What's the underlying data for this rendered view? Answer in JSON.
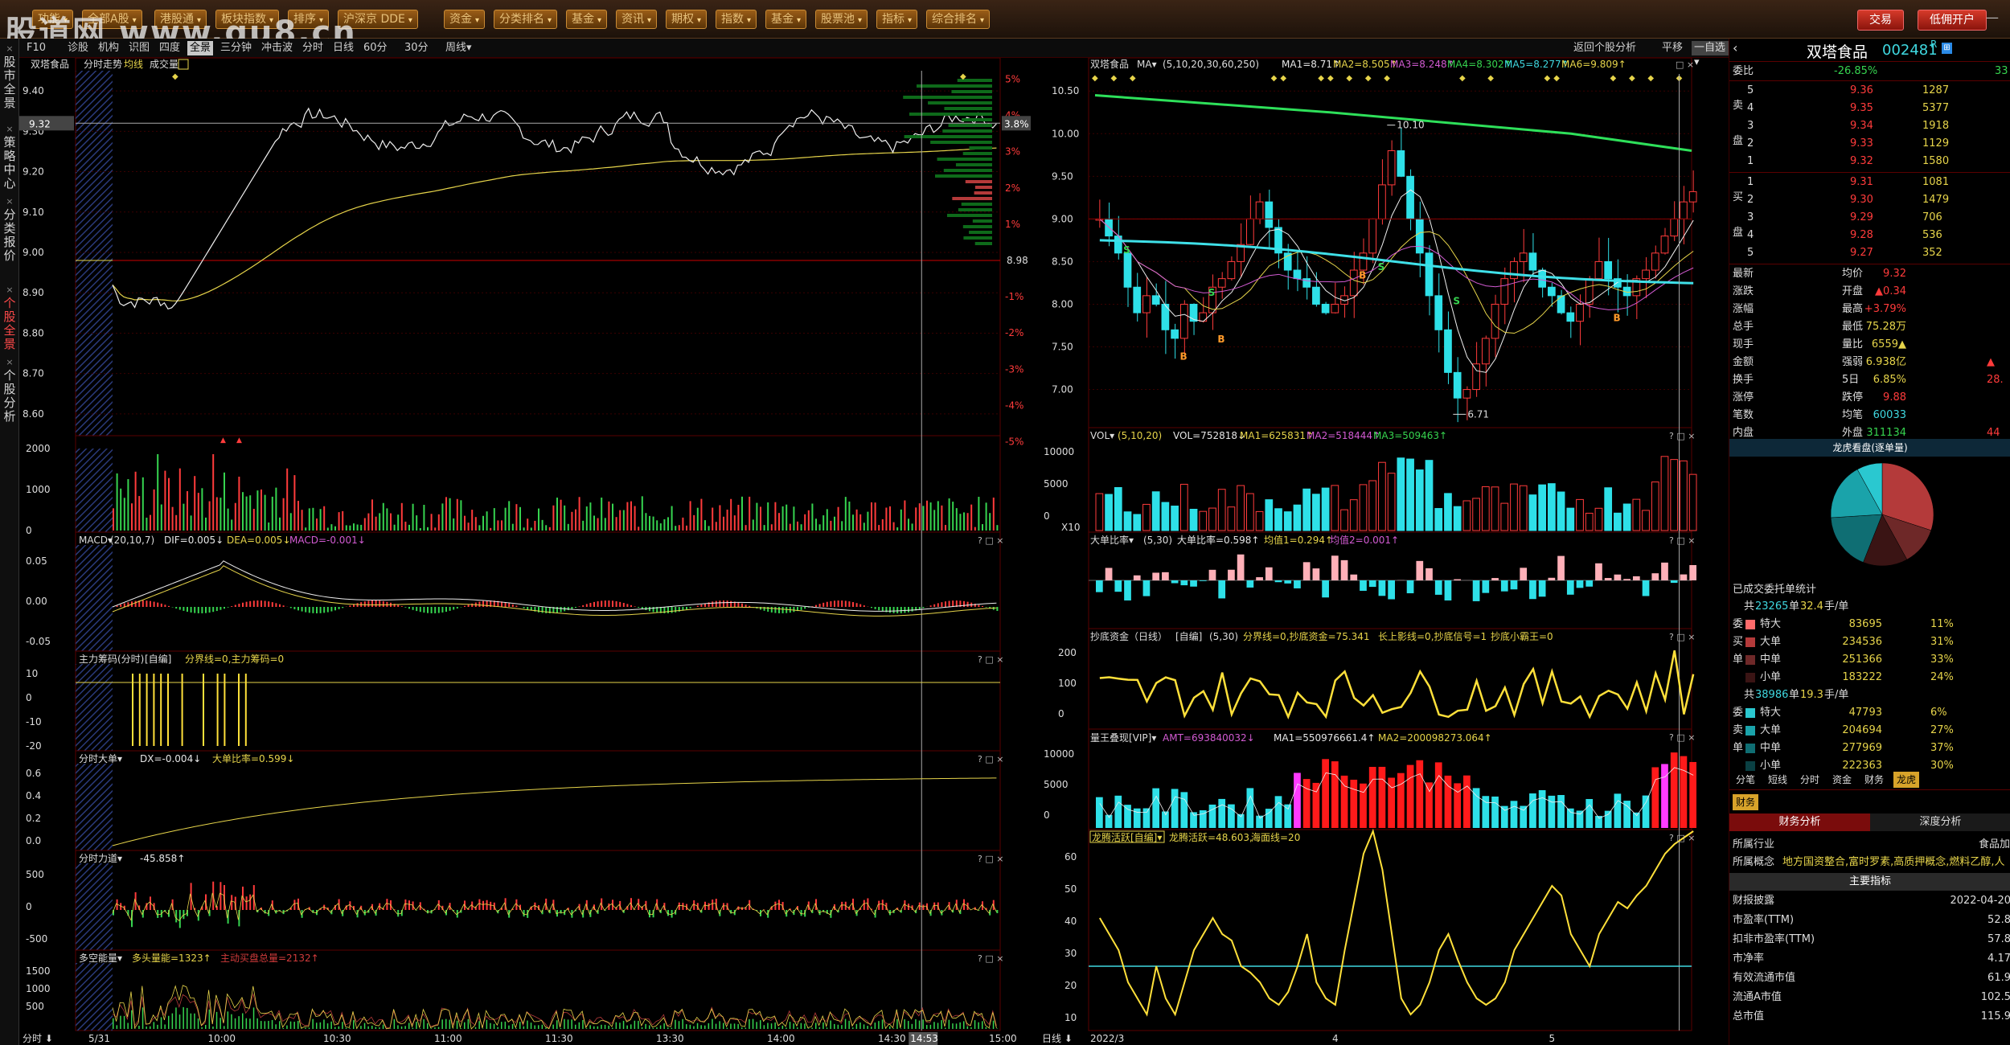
{
  "watermark": "股道网 www.gu8.cn",
  "toolbar": {
    "items": [
      {
        "label": "功能"
      },
      {
        "label": "全部A股"
      },
      {
        "label": "港股通"
      },
      {
        "label": "板块指数"
      },
      {
        "label": "排序"
      },
      {
        "label": "沪深京 DDE"
      },
      {
        "label": "资金"
      },
      {
        "label": "分类排名"
      },
      {
        "label": "基金"
      },
      {
        "label": "资讯"
      },
      {
        "label": "期权"
      },
      {
        "label": "指数"
      },
      {
        "label": "基金"
      },
      {
        "label": "股票池"
      },
      {
        "label": "指标"
      },
      {
        "label": "综合排名"
      }
    ],
    "trade_btn": "交易",
    "open_btn": "低佣开户"
  },
  "leftbar": {
    "sections": [
      {
        "text": "股市全景",
        "active": false
      },
      {
        "text": "策略中心",
        "active": false
      },
      {
        "text": "分类报价",
        "active": false
      },
      {
        "text": "个股全景",
        "active": true
      },
      {
        "text": "个股分析",
        "active": false
      }
    ]
  },
  "menu": {
    "items": [
      "F10",
      "诊股",
      "机构",
      "识图",
      "四度",
      "全景",
      "三分钟",
      "冲击波",
      "分时",
      "日线",
      "60分",
      "30分",
      "周线▾"
    ],
    "active": "全景"
  },
  "midbar": {
    "back": "返回个股分析",
    "flat": "平移",
    "select": "一自选▾"
  },
  "intraday": {
    "title": "双塔食品",
    "sub": "分时走势",
    "avg": "均线",
    "vol": "成交量",
    "price_axis": [
      "9.40",
      "9.30",
      "9.20",
      "9.10",
      "9.00",
      "8.90",
      "8.80",
      "8.70",
      "8.60"
    ],
    "pct_axis": [
      "5%",
      "4%",
      "3%",
      "2%",
      "1%",
      "-1%",
      "-2%",
      "-3%",
      "-4%",
      "-5%"
    ],
    "ref_price": "8.98",
    "cursor_price": "9.32",
    "cursor_pct": "3.8%",
    "vol_axis": [
      "2000",
      "1000",
      "0"
    ],
    "macd": {
      "name": "MACD",
      "params": "(20,10,7)",
      "dif": "DIF=0.005",
      "dea": "DEA=0.005",
      "macd": "MACD=-0.001",
      "axis": [
        "0.05",
        "0.00",
        "-0.05"
      ]
    },
    "zlcm": {
      "name": "主力筹码(分时)",
      "mode": "[自编]",
      "text": "分界线=0,主力筹码=0",
      "axis": [
        "10",
        "0",
        "-10",
        "-20"
      ]
    },
    "dadan": {
      "name": "分时大单",
      "dx": "DX=-0.004",
      "bili": "大单比率=0.599",
      "axis": [
        "0.6",
        "0.4",
        "0.2",
        "0.0"
      ]
    },
    "lidao": {
      "name": "分时力道",
      "val": "-45.858",
      "axis": [
        "500",
        "0",
        "-500"
      ]
    },
    "duokong": {
      "name": "多空能量",
      "bull": "多头量能=1323",
      "bear": "主动买盘总量=2132",
      "axis": [
        "1500",
        "1000",
        "500"
      ]
    },
    "time_axis": [
      "5/31",
      "10:00",
      "10:30",
      "11:00",
      "11:30",
      "13:30",
      "14:00",
      "14:30",
      "15:00"
    ],
    "cursor_time": "14:53",
    "period": "分时"
  },
  "daily": {
    "title": "双塔食品",
    "ma_label": "MA",
    "ma_params": "(5,10,20,30,60,250)",
    "ma_values": [
      {
        "t": "MA1=8.71",
        "c": "#e6e6e6"
      },
      {
        "t": "MA2=8.505",
        "c": "#e6d44a"
      },
      {
        "t": "MA3=8.248",
        "c": "#d25bd2"
      },
      {
        "t": "MA4=8.302",
        "c": "#36d44f"
      },
      {
        "t": "MA5=8.277",
        "c": "#3fd8e0"
      },
      {
        "t": "MA6=9.809",
        "c": "#e6d44a"
      }
    ],
    "price_axis": [
      "10.50",
      "10.00",
      "9.50",
      "9.00",
      "8.50",
      "8.00",
      "7.50",
      "7.00"
    ],
    "high_mark": "10.10",
    "low_mark": "6.71",
    "vol": {
      "name": "VOL",
      "params": "(5,10,20)",
      "v": "VOL=752818",
      "ma1": "MA1=625831",
      "ma2": "MA2=518444",
      "ma3": "MA3=509463",
      "axis": [
        "10000",
        "5000",
        "0"
      ],
      "unit": "X10"
    },
    "dadan": {
      "name": "大单比率",
      "params": "(5,30)",
      "v": "大单比率=0.598",
      "m1": "均值1=0.294",
      "m2": "均值2=0.001"
    },
    "chaodi": {
      "name": "抄底资金（日线）",
      "mode": "[自编]",
      "params": "(5,30)",
      "text": "分界线=0,抄底资金=75.341",
      "t2": "长上影线=0,抄底信号=1",
      "t3": "抄底小霸王=0",
      "axis": [
        "200",
        "100",
        "0"
      ]
    },
    "liangwang": {
      "name": "量王叠现[VIP]",
      "amt": "AMT=693840032",
      "ma1": "MA1=550976661.4",
      "ma2": "MA2=200098273.064",
      "axis": [
        "10000",
        "5000",
        "0"
      ]
    },
    "longteng": {
      "name": "龙腾活跃[自编]",
      "v": "龙腾活跃=48.603",
      "sea": "海面线=20",
      "axis": [
        "60",
        "50",
        "40",
        "30",
        "20",
        "10"
      ]
    },
    "time_axis": [
      "2022/3",
      "4",
      "5"
    ],
    "period": "日线"
  },
  "right": {
    "name": "双塔食品",
    "code": "002481",
    "r_tag": "R",
    "webi": {
      "label": "委比",
      "pct": "-26.85%",
      "diff": "33"
    },
    "asks": [
      {
        "n": "5",
        "p": "9.36",
        "v": "1287"
      },
      {
        "n": "4",
        "p": "9.35",
        "v": "5377"
      },
      {
        "n": "3",
        "p": "9.34",
        "v": "1918"
      },
      {
        "n": "2",
        "p": "9.33",
        "v": "1129"
      },
      {
        "n": "1",
        "p": "9.32",
        "v": "1580"
      }
    ],
    "bids": [
      {
        "n": "1",
        "p": "9.31",
        "v": "1081"
      },
      {
        "n": "2",
        "p": "9.30",
        "v": "1479"
      },
      {
        "n": "3",
        "p": "9.29",
        "v": "706"
      },
      {
        "n": "4",
        "p": "9.28",
        "v": "536"
      },
      {
        "n": "5",
        "p": "9.27",
        "v": "352"
      }
    ],
    "sell_chars": [
      "卖",
      "盘"
    ],
    "buy_chars": [
      "买",
      "盘"
    ],
    "quote": [
      {
        "l": "最新",
        "v": "9.32",
        "c": "#ff3b3b",
        "l2": "均价",
        "v2": ""
      },
      {
        "l": "涨跌",
        "v": "▲0.34",
        "c": "#ff3b3b",
        "l2": "开盘",
        "v2": ""
      },
      {
        "l": "涨幅",
        "v": "+3.79%",
        "c": "#ff3b3b",
        "l2": "最高",
        "v2": ""
      },
      {
        "l": "总手",
        "v": "75.28万",
        "c": "#e6d44a",
        "l2": "最低",
        "v2": ""
      },
      {
        "l": "现手",
        "v": "6559▲",
        "c": "#e6d44a",
        "l2": "量比",
        "v2": ""
      },
      {
        "l": "金额",
        "v": "6.938亿",
        "c": "#e6d44a",
        "l2": "强弱",
        "v2": "▲"
      },
      {
        "l": "换手",
        "v": "6.85%",
        "c": "#e6d44a",
        "l2": "5日",
        "v2": "28."
      },
      {
        "l": "涨停",
        "v": "9.88",
        "c": "#ff3b3b",
        "l2": "跌停",
        "v2": ""
      },
      {
        "l": "笔数",
        "v": "60033",
        "c": "#3fd8e0",
        "l2": "均笔",
        "v2": ""
      },
      {
        "l": "内盘",
        "v": "311134",
        "c": "#36d44f",
        "l2": "外盘",
        "v2": "44"
      }
    ],
    "pie_title": "龙虎看盘(逐单量)",
    "pie": [
      {
        "v": 30,
        "c": "#b43a3a"
      },
      {
        "v": 12,
        "c": "#6e2828"
      },
      {
        "v": 14,
        "c": "#3a1414"
      },
      {
        "v": 18,
        "c": "#0f6e73"
      },
      {
        "v": 18,
        "c": "#1aa3aa"
      },
      {
        "v": 8,
        "c": "#2ac8d0"
      }
    ],
    "deal_title": "已成交委托单统计",
    "buy_total": {
      "pre": "共",
      "a": "23265",
      "mid": "单",
      "b": "32.4",
      "post": "手/单"
    },
    "buy_rows": [
      {
        "side": "委",
        "l": "特大",
        "v": "83695",
        "p": "11%",
        "c": "#ff6b6b"
      },
      {
        "side": "买",
        "l": "大单",
        "v": "234536",
        "p": "31%",
        "c": "#b43a3a"
      },
      {
        "side": "单",
        "l": "中单",
        "v": "251366",
        "p": "33%",
        "c": "#6e2828"
      },
      {
        "side": "",
        "l": "小单",
        "v": "183222",
        "p": "24%",
        "c": "#3a1414"
      }
    ],
    "sell_total": {
      "pre": "共",
      "a": "38986",
      "mid": "单",
      "b": "19.3",
      "post": "手/单"
    },
    "sell_rows": [
      {
        "side": "委",
        "l": "特大",
        "v": "47793",
        "p": "6%",
        "c": "#2ac8d0"
      },
      {
        "side": "卖",
        "l": "大单",
        "v": "204694",
        "p": "27%",
        "c": "#1aa3aa"
      },
      {
        "side": "单",
        "l": "中单",
        "v": "277969",
        "p": "37%",
        "c": "#0f6e73"
      },
      {
        "side": "",
        "l": "小单",
        "v": "222363",
        "p": "30%",
        "c": "#0a4043"
      }
    ],
    "tabs": [
      "分笔",
      "短线",
      "分时",
      "资金",
      "财务",
      "龙虎"
    ],
    "active_tab": "龙虎",
    "fin_tab": "财务",
    "fin_sub": [
      "财务分析",
      "深度分析"
    ],
    "industry": {
      "l": "所属行业",
      "v": "食品加"
    },
    "concept": {
      "l": "所属概念",
      "v": "地方国资整合,富时罗素,高质押概念,燃料乙醇,人"
    },
    "main_idx": "主要指标",
    "fin_rows": [
      {
        "l": "财报披露",
        "v": "2022-04-20"
      },
      {
        "l": "市盈率(TTM)",
        "v": "52.8"
      },
      {
        "l": "扣非市盈率(TTM)",
        "v": "57.8"
      },
      {
        "l": "市净率",
        "v": "4.17"
      },
      {
        "l": "有效流通市值",
        "v": "61.9"
      },
      {
        "l": "流通A市值",
        "v": "102.5"
      },
      {
        "l": "总市值",
        "v": "115.9"
      }
    ]
  },
  "pct_bars": [
    {
      "v": 0.0
    },
    {
      "v": 0.0
    }
  ]
}
